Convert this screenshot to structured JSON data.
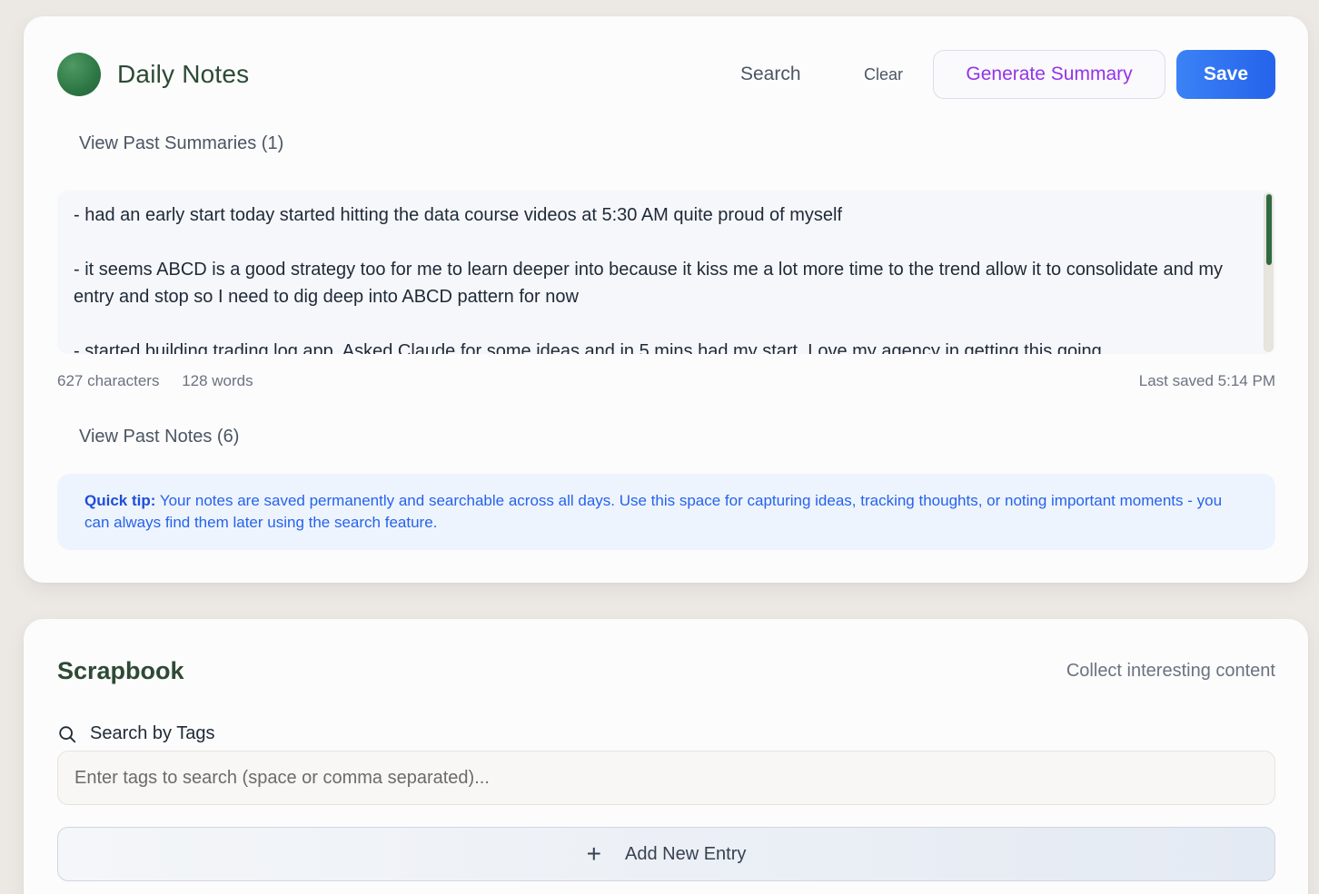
{
  "notes": {
    "title": "Daily Notes",
    "search_label": "Search",
    "clear_label": "Clear",
    "generate_summary_label": "Generate Summary",
    "save_label": "Save",
    "view_past_summaries": "View Past Summaries (1)",
    "content": "- had an early start today started hitting the data course videos at 5:30 AM quite proud of myself\n\n- it seems ABCD is a good strategy too for me to learn deeper into because it kiss me a lot more time to the trend allow it to consolidate and my entry and stop so I need to dig deep into ABCD pattern for now\n\n- started building trading log app. Asked Claude for some ideas and in 5 mins had my start. Love my agency in getting this going",
    "characters": "627 characters",
    "words": "128 words",
    "last_saved": "Last saved 5:14 PM",
    "view_past_notes": "View Past Notes (6)",
    "tip_label": "Quick tip:",
    "tip_text": " Your notes are saved permanently and searchable across all days. Use this space for capturing ideas, tracking thoughts, or noting important moments - you can always find them later using the search feature."
  },
  "scrapbook": {
    "title": "Scrapbook",
    "subtitle": "Collect interesting content",
    "search_label": "Search by Tags",
    "search_placeholder": "Enter tags to search (space or comma separated)...",
    "add_label": "Add New Entry"
  },
  "colors": {
    "accent_green": "#2d4a35",
    "save_blue": "#2563eb",
    "summary_purple": "#9333ea",
    "tip_blue": "#1d4ed8"
  },
  "icons": {
    "avatar": "green-circle",
    "search": "search-icon",
    "add": "plus-icon"
  }
}
